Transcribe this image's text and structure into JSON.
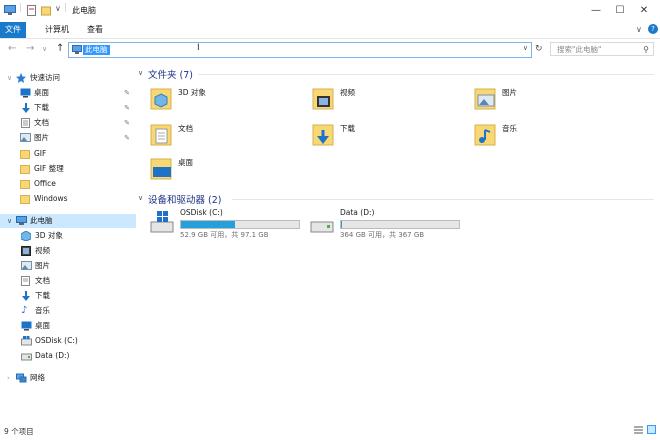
{
  "window": {
    "title": "此电脑",
    "controls": {
      "minimize": "—",
      "maximize": "☐",
      "close": "✕"
    }
  },
  "ribbon": {
    "tabs": [
      "文件",
      "计算机",
      "查看"
    ]
  },
  "address": {
    "path": "此电脑",
    "search_placeholder": "搜索\"此电脑\""
  },
  "nav": {
    "quick_access": "快速访问",
    "pinned": [
      {
        "label": "桌面",
        "icon": "desktop-icon"
      },
      {
        "label": "下载",
        "icon": "download-icon"
      },
      {
        "label": "文档",
        "icon": "document-icon"
      },
      {
        "label": "图片",
        "icon": "picture-icon"
      }
    ],
    "folders": [
      "GIF",
      "GIF 整理",
      "Office",
      "Windows"
    ],
    "this_pc": "此电脑",
    "pc_items": [
      {
        "label": "3D 对象",
        "icon": "3d-objects-icon"
      },
      {
        "label": "视频",
        "icon": "video-icon"
      },
      {
        "label": "图片",
        "icon": "picture-icon"
      },
      {
        "label": "文档",
        "icon": "document-icon"
      },
      {
        "label": "下载",
        "icon": "download-icon"
      },
      {
        "label": "音乐",
        "icon": "music-icon"
      },
      {
        "label": "桌面",
        "icon": "desktop-icon"
      },
      {
        "label": "OSDisk (C:)",
        "icon": "windows-drive-icon"
      },
      {
        "label": "Data (D:)",
        "icon": "drive-icon"
      }
    ],
    "network": "网络"
  },
  "content": {
    "folders_heading": "文件夹 (7)",
    "folders": [
      {
        "label": "3D 对象",
        "icon": "3d-objects-folder-icon"
      },
      {
        "label": "视频",
        "icon": "video-folder-icon"
      },
      {
        "label": "图片",
        "icon": "picture-folder-icon"
      },
      {
        "label": "文档",
        "icon": "document-folder-icon"
      },
      {
        "label": "下载",
        "icon": "download-folder-icon"
      },
      {
        "label": "音乐",
        "icon": "music-folder-icon"
      },
      {
        "label": "桌面",
        "icon": "desktop-folder-icon"
      }
    ],
    "drives_heading": "设备和驱动器 (2)",
    "drives": [
      {
        "name": "OSDisk (C:)",
        "size": "52.9 GB 可用，共 97.1 GB",
        "used_fraction": 0.455,
        "icon": "windows-drive-icon"
      },
      {
        "name": "Data (D:)",
        "size": "364 GB 可用，共 367 GB",
        "used_fraction": 0.01,
        "icon": "drive-icon"
      }
    ]
  },
  "status": {
    "count": "9 个项目"
  },
  "colors": {
    "accent": "#1979ca",
    "selection": "#cce8ff",
    "heading": "#1e3287",
    "folder": "#f8d775",
    "bar": "#26a0da"
  }
}
